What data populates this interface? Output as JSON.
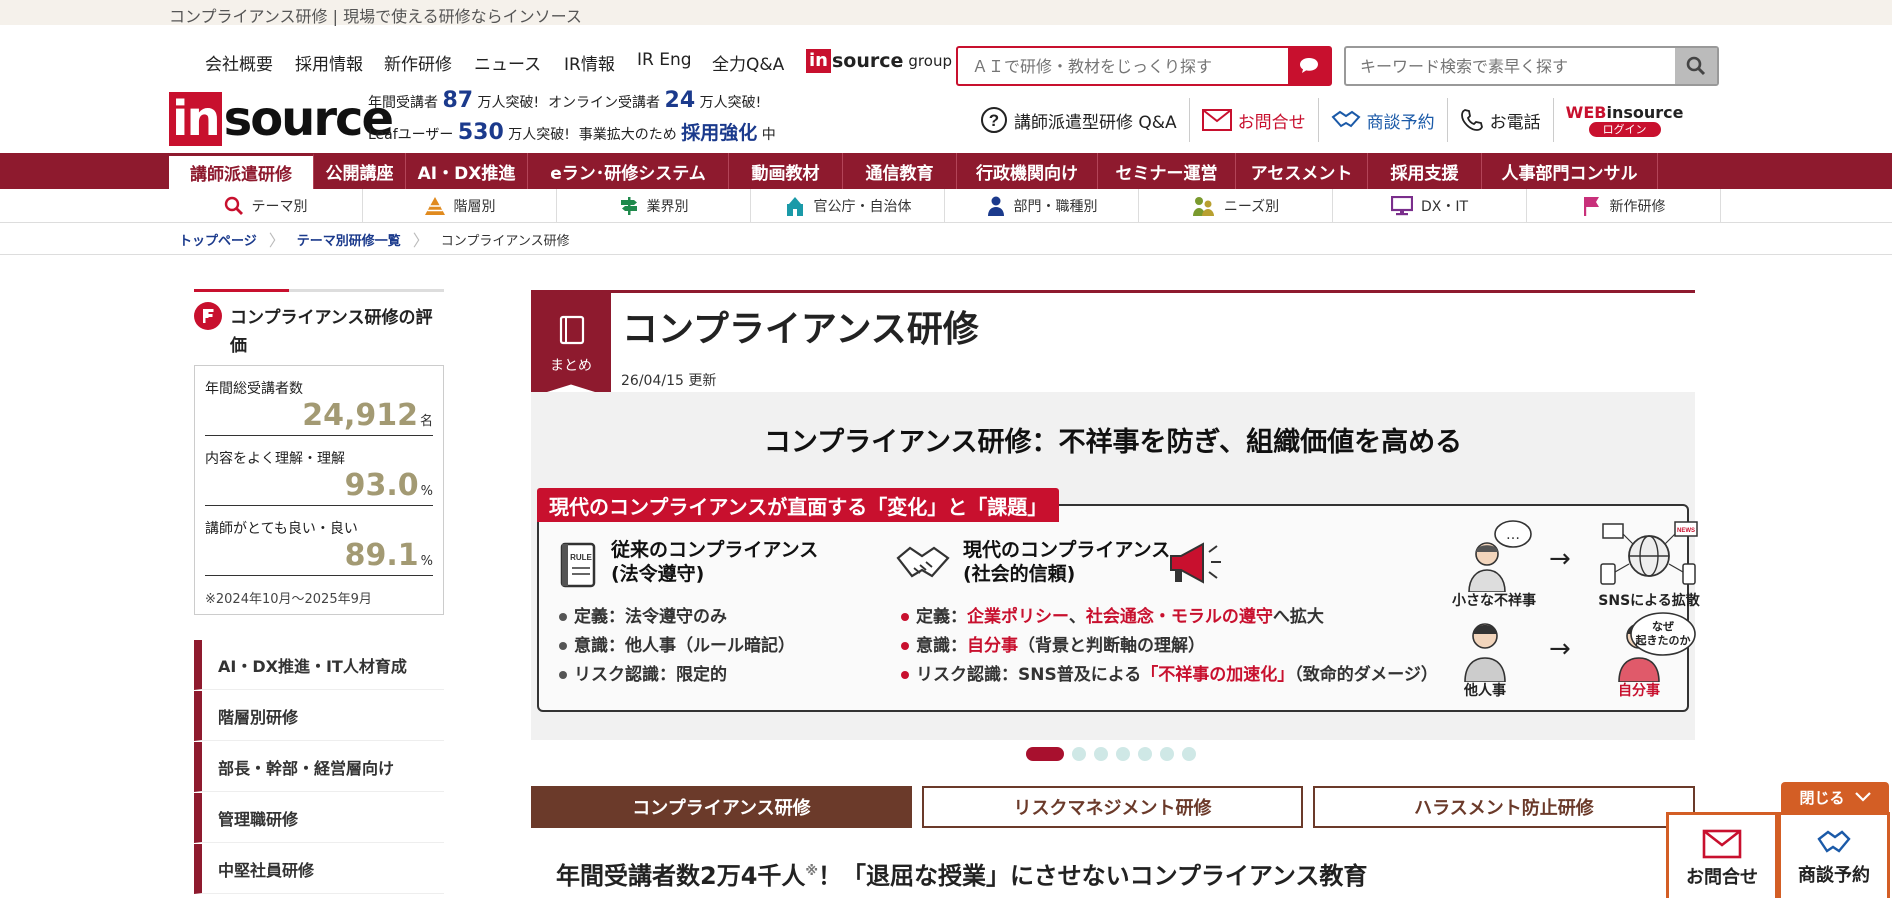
{
  "top_strip": {
    "text": "コンプライアンス研修 | 現場で使える研修ならインソース"
  },
  "header": {
    "links": [
      "会社概要",
      "採用情報",
      "新作研修",
      "ニュース",
      "IR情報",
      "IR Eng",
      "全力Q&A"
    ],
    "group_logo": {
      "in": "in",
      "source": "source",
      "group": "group"
    },
    "ai_search": {
      "placeholder": "ＡＩで研修・教材をじっくり探す"
    },
    "keyword_search": {
      "placeholder": "キーワード検索で素早く探す"
    },
    "logo": {
      "in": "in",
      "source": "source"
    },
    "stats": {
      "line1_a": "年間受講者",
      "line1_n1": "87",
      "line1_b": "万人突破!",
      "line1_c": "オンライン受講者",
      "line1_n2": "24",
      "line1_d": "万人突破!",
      "line2_a": "Leafユーザー",
      "line2_n": "530",
      "line2_b": "万人突破!",
      "line2_c": "事業拡大のため",
      "line2_d": "採用強化",
      "line2_e": "中"
    },
    "utility": {
      "qa": "講師派遣型研修 Q&A",
      "contact": "お問合せ",
      "meeting": "商談予約",
      "phone": "お電話",
      "web_prefix": "WEB",
      "web_suffix": "insource",
      "login": "ログイン"
    }
  },
  "main_nav": [
    "講師派遣研修",
    "公開講座",
    "AI・DX推進",
    "eラン･研修システム",
    "動画教材",
    "通信教育",
    "行政機関向け",
    "セミナー運営",
    "アセスメント",
    "採用支援",
    "人事部門コンサル"
  ],
  "sub_nav": [
    {
      "label": "テーマ別",
      "icon": "search-icon",
      "color": "#c8102e"
    },
    {
      "label": "階層別",
      "icon": "pyramid-icon",
      "color": "#e08a1e"
    },
    {
      "label": "業界別",
      "icon": "signpost-icon",
      "color": "#1f8a4c"
    },
    {
      "label": "官公庁・自治体",
      "icon": "building-icon",
      "color": "#1a9aa8"
    },
    {
      "label": "部門・職種別",
      "icon": "person-icon",
      "color": "#1b3a8c"
    },
    {
      "label": "ニーズ別",
      "icon": "people-icon",
      "color": "#7a9a2e"
    },
    {
      "label": "DX・IT",
      "icon": "monitor-icon",
      "color": "#7a2e8c"
    },
    {
      "label": "新作研修",
      "icon": "flag-icon",
      "color": "#c8307a"
    }
  ],
  "breadcrumb": [
    "トップページ",
    "テーマ別研修一覧",
    "コンプライアンス研修"
  ],
  "sidebar": {
    "eval_title": "コンプライアンス研修の評価",
    "evals": [
      {
        "label": "年間総受講者数",
        "value": "24,912",
        "unit": "名"
      },
      {
        "label": "内容をよく理解・理解",
        "value": "93.0",
        "unit": "%"
      },
      {
        "label": "講師がとても良い・良い",
        "value": "89.1",
        "unit": "%"
      }
    ],
    "eval_note": "※2024年10月～2025年9月",
    "links": [
      "AI・DX推進・IT人材育成",
      "階層別研修",
      "部長・幹部・経営層向け",
      "管理職研修",
      "中堅社員研修"
    ]
  },
  "article": {
    "badge": "まとめ",
    "title": "コンプライアンス研修",
    "updated": "26/04/15 更新",
    "banner": {
      "headline": "コンプライアンス研修：不祥事を防ぎ、組織価値を高める",
      "tag": "現代のコンプライアンスが直面する「変化」と「課題」",
      "rule": "RULE",
      "old_title_1": "従来のコンプライアンス",
      "old_title_2": "(法令遵守)",
      "old_items": [
        "定義：法令遵守のみ",
        "意識：他人事（ルール暗記）",
        "リスク認識：限定的"
      ],
      "new_title_1": "現代のコンプライアンス",
      "new_title_2": "(社会的信頼)",
      "new_l1": {
        "a": "定義：",
        "b": "企業ポリシー",
        "c": "、",
        "d": "社会通念・モラルの遵守",
        "e": "へ拡大"
      },
      "new_l2": {
        "a": "意識：",
        "b": "自分事",
        "c": "（背景と判断軸の理解）"
      },
      "new_l3": {
        "a": "リスク認識：SNS普及による",
        "b": "「不祥事の加速化」",
        "c": "（致命的ダメージ）"
      },
      "fig": {
        "small": "小さな不祥事",
        "sns": "SNSによる拡散",
        "other": "他人事",
        "self": "自分事",
        "bubble_1": "なぜ",
        "bubble_2": "起きたのか",
        "bubble_dots": "…",
        "news": "NEWS"
      }
    },
    "carousel": {
      "count": 7,
      "active": 0
    },
    "tabs": [
      "コンプライアンス研修",
      "リスクマネジメント研修",
      "ハラスメント防止研修"
    ],
    "h2_a": "年間受講者数2万4千人",
    "h2_sup": "※",
    "h2_b": "！「退屈な授業」にさせないコンプライアンス教育"
  },
  "floating": {
    "close": "閉じる",
    "contact": "お問合せ",
    "meeting": "商談予約"
  },
  "colors": {
    "brand_red": "#c8102e",
    "nav_maroon": "#8e1a2e",
    "tab_brown": "#6b3a2a",
    "stat_gold": "#a39a73",
    "float_orange": "#d35e25"
  }
}
